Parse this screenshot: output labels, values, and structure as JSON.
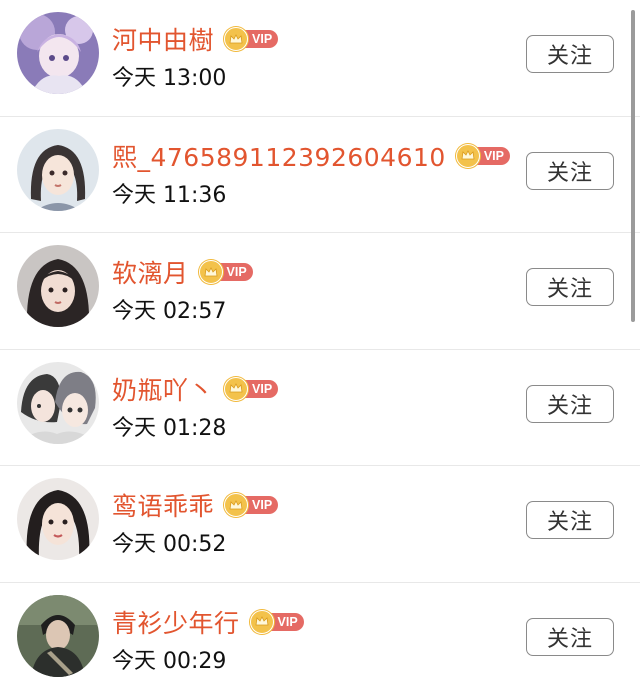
{
  "accent_color": "#e2552f",
  "users": [
    {
      "name": "河中由樹",
      "time": "今天 13:00",
      "vip": "VIP",
      "follow_label": "关注"
    },
    {
      "name": "熙_476589112392604610",
      "time": "今天 11:36",
      "vip": "VIP",
      "follow_label": "关注"
    },
    {
      "name": "软漓月",
      "time": "今天 02:57",
      "vip": "VIP",
      "follow_label": "关注"
    },
    {
      "name": "奶瓶吖丶",
      "time": "今天 01:28",
      "vip": "VIP",
      "follow_label": "关注"
    },
    {
      "name": "鸾语乖乖",
      "time": "今天 00:52",
      "vip": "VIP",
      "follow_label": "关注"
    },
    {
      "name": "青衫少年行",
      "time": "今天 00:29",
      "vip": "VIP",
      "follow_label": "关注"
    }
  ]
}
